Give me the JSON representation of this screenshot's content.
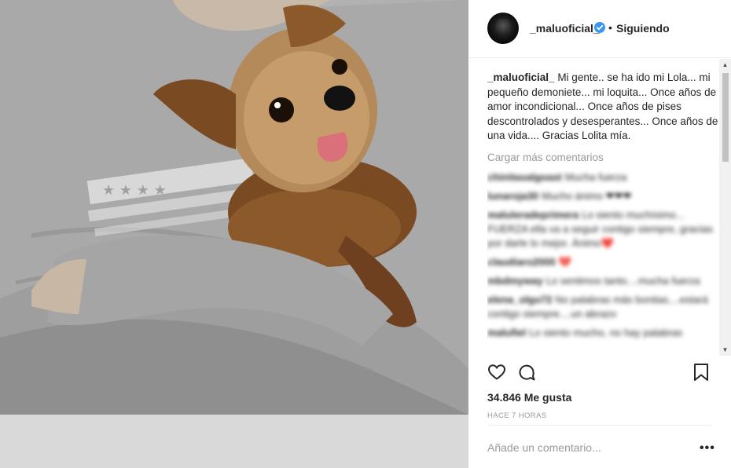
{
  "post": {
    "username": "_maluoficial_",
    "follow_status": "Siguiendo",
    "separator": "•"
  },
  "caption": {
    "username": "_maluoficial_",
    "text": "Mi gente.. se ha ido mi Lola... mi pequeño demoniete... mi loquita... Once años de amor incondicional... Once años de pises descontrolados y desesperantes... Once años de una vida.... Gracias Lolita mía."
  },
  "load_more": "Cargar más comentarios",
  "comments": [
    {
      "user": "chinitasalgoast",
      "text": "Mucha fuerza"
    },
    {
      "user": "lunaroja30",
      "text": "Mucho ánimo ❤❤❤"
    },
    {
      "user": "maluleradeprimera",
      "text": "Lo siento muchísimo... FUERZA ella va a seguir contigo siempre, gracias por darle lo mejor. Ánimo❤️"
    },
    {
      "user": "claudiaro2000",
      "text": "💔"
    },
    {
      "user": "mbdmyway",
      "text": "Lo sentimos tanto....mucha fuerza"
    },
    {
      "user": "elena_olgo72",
      "text": "No palabras más bonitas....estará contigo siempre....un abrazo"
    },
    {
      "user": "malufiel",
      "text": "Lo siento mucho, no hay palabras"
    }
  ],
  "likes": "34.846 Me gusta",
  "time": "HACE 7 HORAS",
  "add_comment_placeholder": "Añade un comentario...",
  "more_label": "•••",
  "colors": {
    "text": "#262626",
    "secondary": "#999999",
    "verified": "#3897f0",
    "divider": "#efefef"
  },
  "icons": [
    "heart-icon",
    "comment-icon",
    "bookmark-icon",
    "verified-badge-icon",
    "more-options-icon"
  ]
}
